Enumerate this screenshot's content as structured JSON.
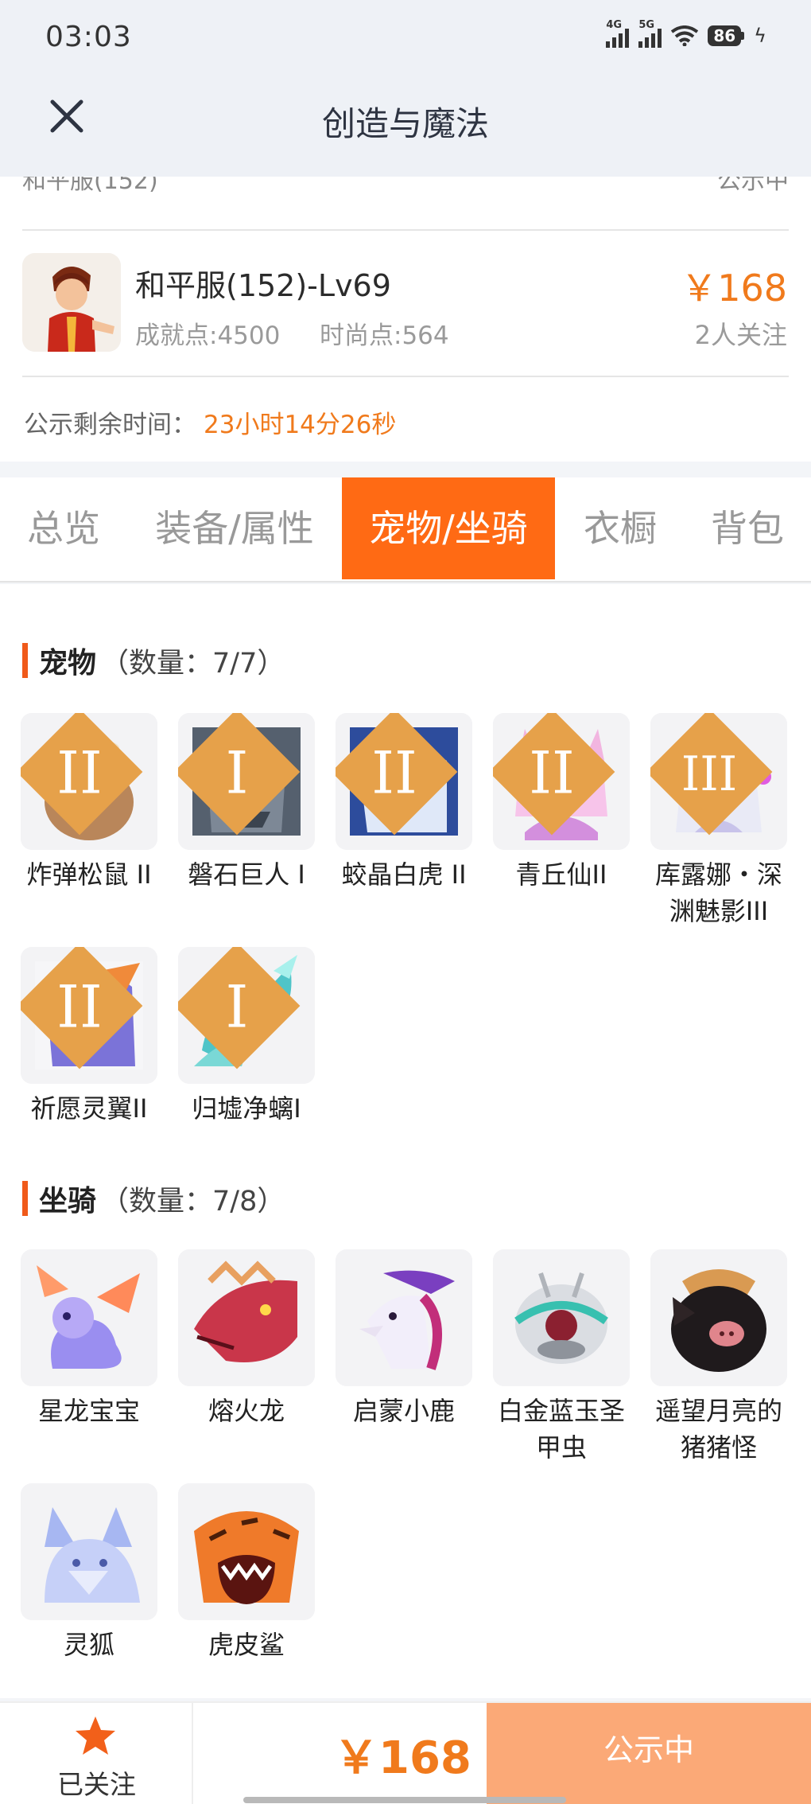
{
  "status_bar": {
    "time": "03:03",
    "net1": "4G",
    "net2": "5G",
    "battery": "86"
  },
  "header": {
    "title": "创造与魔法",
    "close_icon": "close-icon"
  },
  "listing": {
    "clipped_server": "和平服(152)",
    "clipped_status": "公示中",
    "name": "和平服(152)-Lv69",
    "achievement": "成就点:4500",
    "fashion": "时尚点:564",
    "price": "￥168",
    "followers": "2人关注",
    "remain_label": "公示剩余时间：",
    "remain_time": "23小时14分26秒"
  },
  "tabs": [
    {
      "label": "总览"
    },
    {
      "label": "装备/属性"
    },
    {
      "label": "宠物/坐骑",
      "active": true
    },
    {
      "label": "衣橱"
    },
    {
      "label": "背包"
    }
  ],
  "pets": {
    "title": "宠物",
    "count": "（数量：7/7）",
    "items": [
      {
        "label": "炸弹松鼠 II",
        "rank": "II"
      },
      {
        "label": "磐石巨人 I",
        "rank": "I"
      },
      {
        "label": "蛟晶白虎 II",
        "rank": "II"
      },
      {
        "label": "青丘仙II",
        "rank": "II"
      },
      {
        "label": "库露娜・深渊魅影III",
        "rank": "III"
      },
      {
        "label": "祈愿灵翼II",
        "rank": "II"
      },
      {
        "label": "归墟净螭I",
        "rank": "I"
      }
    ]
  },
  "mounts": {
    "title": "坐骑",
    "count": "（数量：7/8）",
    "items": [
      {
        "label": "星龙宝宝"
      },
      {
        "label": "熔火龙"
      },
      {
        "label": "启蒙小鹿"
      },
      {
        "label": "白金蓝玉圣甲虫"
      },
      {
        "label": "遥望月亮的猪猪怪"
      },
      {
        "label": "灵狐"
      },
      {
        "label": "虎皮鲨"
      }
    ]
  },
  "bottom": {
    "follow_label": "已关注",
    "price": "￥168",
    "status_button": "公示中"
  },
  "colors": {
    "accent": "#ff6a14",
    "price": "#f07a1c",
    "status_button": "#fba977"
  }
}
